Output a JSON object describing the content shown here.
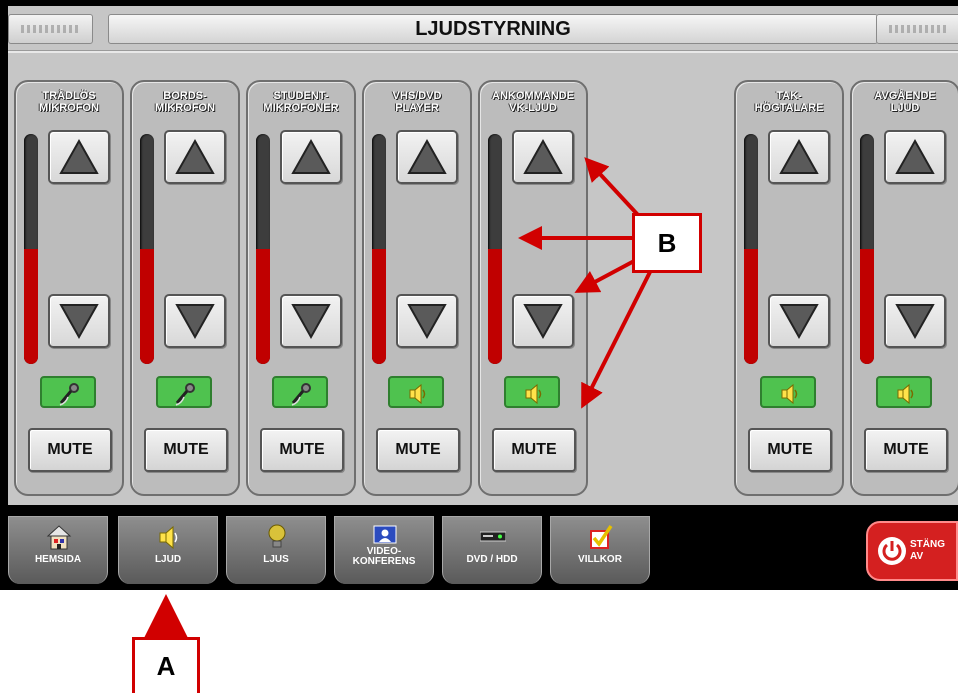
{
  "header": {
    "title": "LJUDSTYRNING"
  },
  "channels": [
    {
      "label": "TRÅDLÖS\nMIKROFON",
      "level": 0.5,
      "source_icon": "microphone-icon",
      "mute_label": "MUTE"
    },
    {
      "label": "BORDS-\nMIKROFON",
      "level": 0.5,
      "source_icon": "microphone-icon",
      "mute_label": "MUTE"
    },
    {
      "label": "STUDENT-\nMIKROFONER",
      "level": 0.5,
      "source_icon": "microphone-icon",
      "mute_label": "MUTE"
    },
    {
      "label": "VHS/DVD\nPLAYER",
      "level": 0.5,
      "source_icon": "speaker-icon",
      "mute_label": "MUTE"
    },
    {
      "label": "ANKOMMANDE\nVK-LJUD",
      "level": 0.5,
      "source_icon": "speaker-icon",
      "mute_label": "MUTE"
    },
    {
      "label": "TAK-\nHÖGTALARE",
      "level": 0.5,
      "source_icon": "speaker-icon",
      "mute_label": "MUTE"
    },
    {
      "label": "AVGÅENDE\nLJUD",
      "level": 0.5,
      "source_icon": "speaker-icon",
      "mute_label": "MUTE"
    }
  ],
  "nav": [
    {
      "label": "HEMSIDA",
      "icon": "house-icon"
    },
    {
      "label": "LJUD",
      "icon": "speaker-icon"
    },
    {
      "label": "LJUS",
      "icon": "lightbulb-icon"
    },
    {
      "label": "VIDEO-\nKONFERENS",
      "icon": "video-conference-icon"
    },
    {
      "label": "DVD / HDD",
      "icon": "dvd-player-icon"
    },
    {
      "label": "VILLKOR",
      "icon": "checkbox-icon"
    }
  ],
  "power": {
    "label": "STÄNG\nAV",
    "icon": "power-icon"
  },
  "annotations": {
    "a": "A",
    "b": "B"
  },
  "colors": {
    "meter_red": "#c00000",
    "source_green": "#4fc24f",
    "power_red": "#d42020",
    "callout_red": "#d10000"
  }
}
